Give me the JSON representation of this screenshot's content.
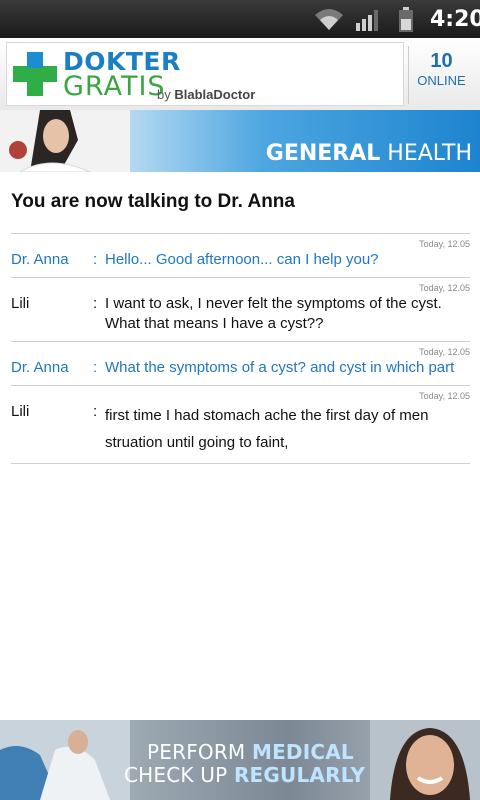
{
  "status_bar": {
    "time": "4:20",
    "icons": [
      "wifi-icon",
      "signal-icon",
      "battery-icon"
    ]
  },
  "header": {
    "brand_line1": "DOKTER",
    "brand_line2": "GRATIS",
    "brand_by": "by",
    "brand_by_name": "BlablaDoctor",
    "online_count": "10",
    "online_label": "ONLINE"
  },
  "banner": {
    "title_strong": "GENERAL",
    "title_rest": "HEALTH"
  },
  "chat": {
    "title": "You are now talking to Dr. Anna",
    "messages": [
      {
        "time": "Today, 12.05",
        "sender": "Dr. Anna",
        "text": "Hello... Good afternoon... can I help you?",
        "role": "doctor"
      },
      {
        "time": "Today, 12.05",
        "sender": "Lili",
        "text": "I want to ask, I never felt the symptoms of the cyst. What that means I have a cyst??",
        "role": "patient"
      },
      {
        "time": "Today, 12.05",
        "sender": "Dr. Anna",
        "text": "What the symptoms of a cyst? and cyst in which part",
        "role": "doctor"
      },
      {
        "time": "Today, 12.05",
        "sender": "Lili",
        "text": "first time I had stomach ache the first day of men struation until going to faint,",
        "role": "patient"
      }
    ]
  },
  "footer_ad": {
    "line1_a": "PERFORM",
    "line1_b": "MEDICAL",
    "line2_a": "CHECK UP",
    "line2_b": "REGULARLY"
  },
  "colors": {
    "brand_blue": "#1c7fc4",
    "brand_green": "#3ba63f",
    "doctor_text": "#1f76c4"
  }
}
